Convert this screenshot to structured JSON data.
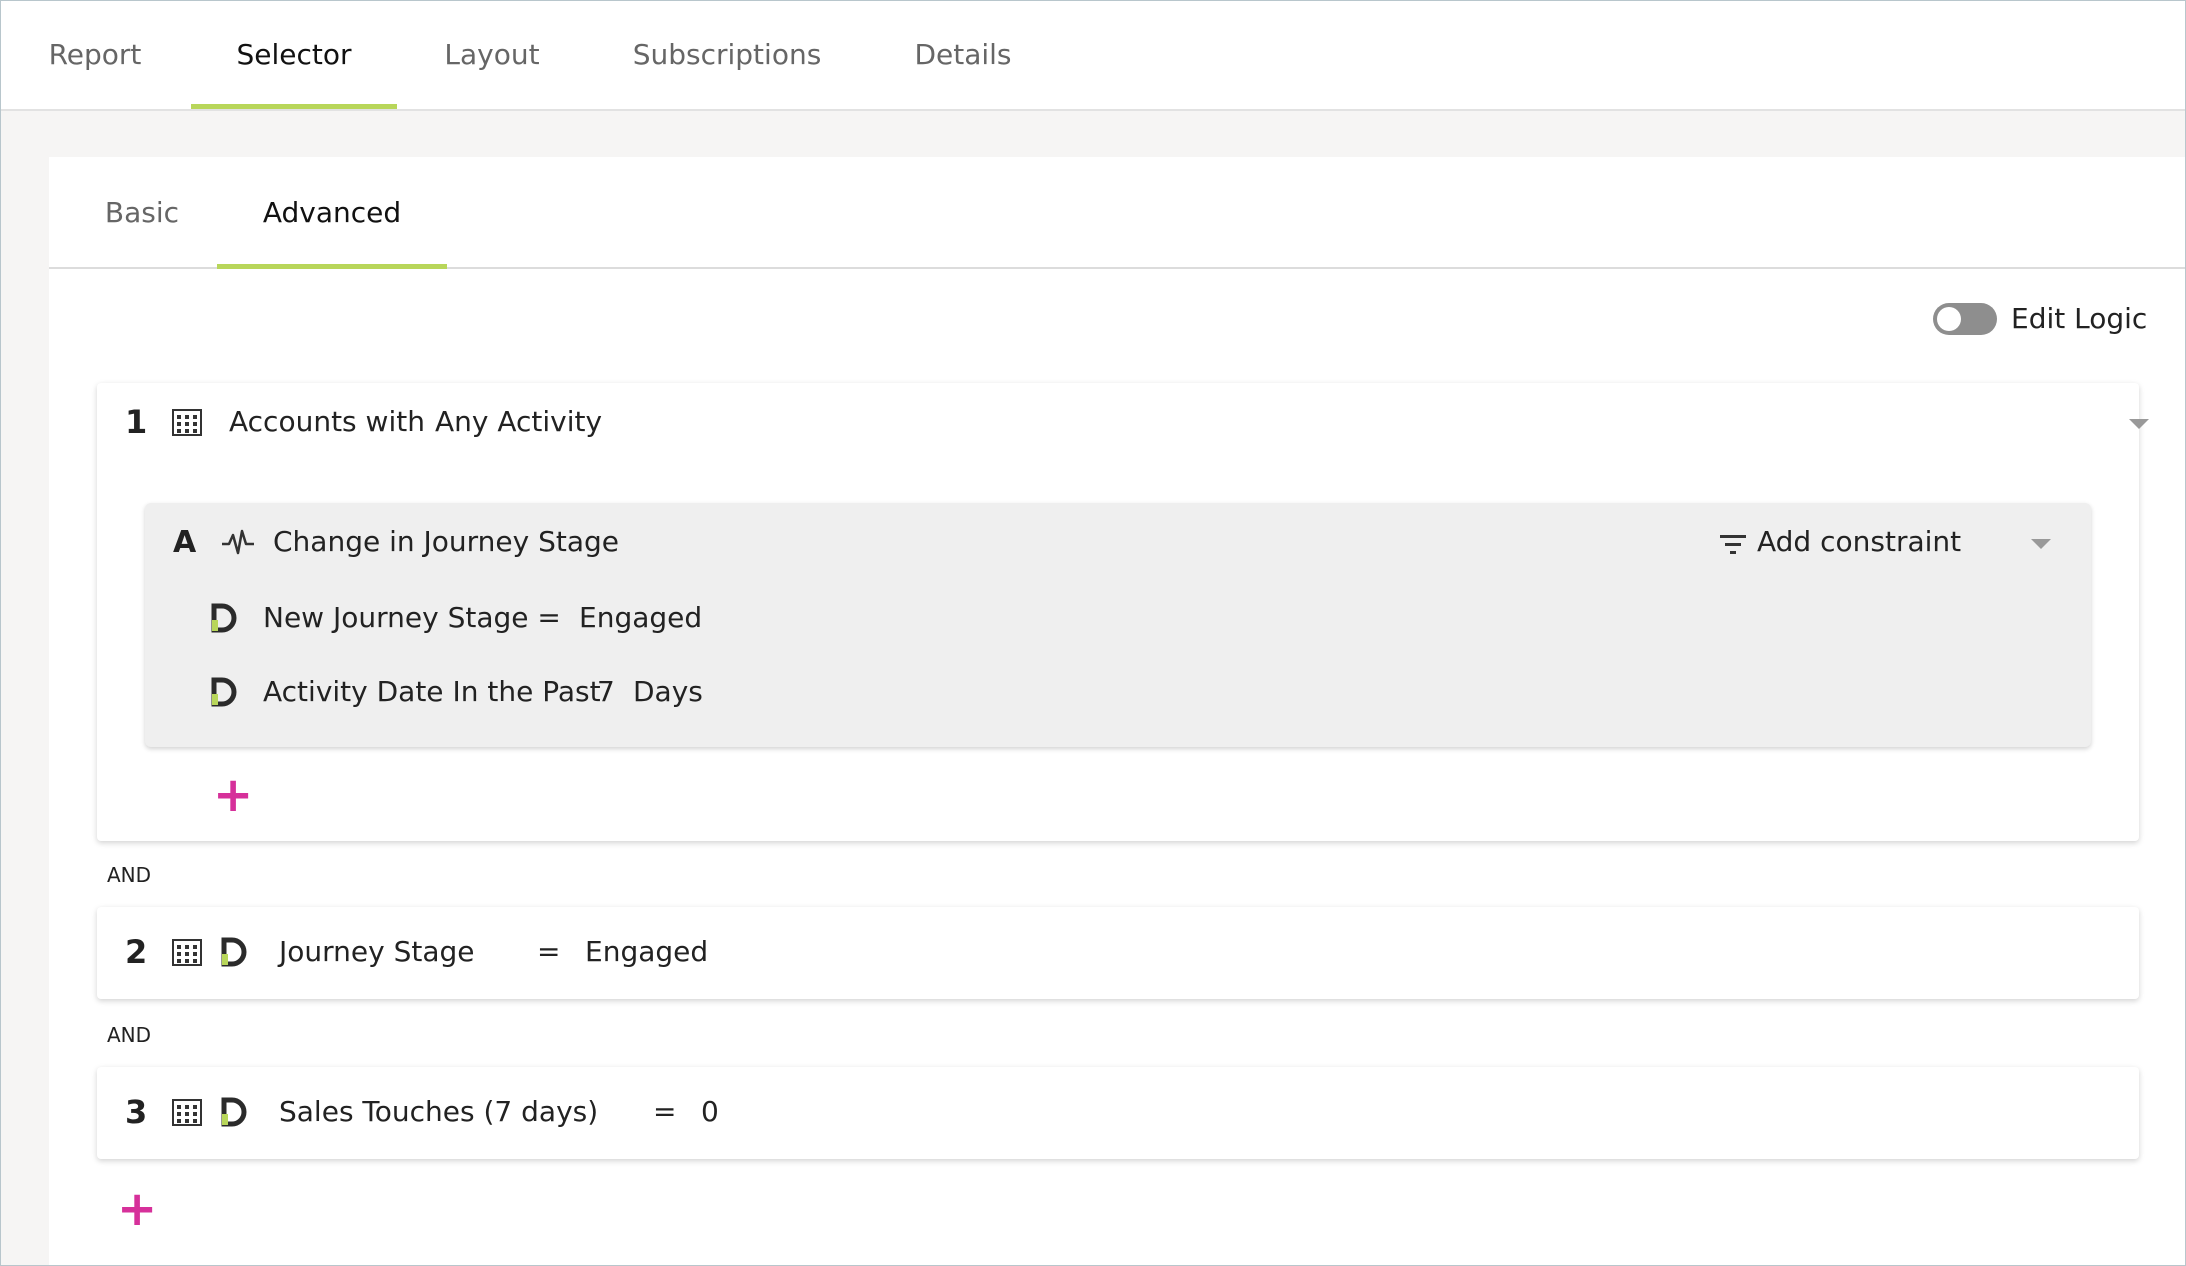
{
  "top_tabs": [
    "Report",
    "Selector",
    "Layout",
    "Subscriptions",
    "Details"
  ],
  "active_top_tab": "Selector",
  "sub_tabs": [
    "Basic",
    "Advanced"
  ],
  "active_sub_tab": "Advanced",
  "edit_logic_label": "Edit Logic",
  "edit_logic_on": false,
  "accent_color": "#b8d65a",
  "plus_color": "#d6309a",
  "criteria": [
    {
      "number": "1",
      "object_label": "Accounts with",
      "activity_label": "Any Activity",
      "sub": {
        "letter": "A",
        "title": "Change in Journey Stage",
        "add_constraint_label": "Add constraint",
        "constraints": [
          {
            "field": "New Journey Stage =",
            "value": "Engaged"
          },
          {
            "field": "Activity Date In the Past",
            "value": "7",
            "unit": "Days"
          }
        ]
      }
    },
    {
      "number": "2",
      "field": "Journey Stage",
      "operator": "=",
      "value": "Engaged"
    },
    {
      "number": "3",
      "field": "Sales Touches (7 days)",
      "operator": "=",
      "value": "0"
    }
  ],
  "and_label": "AND",
  "plus_label": "+"
}
